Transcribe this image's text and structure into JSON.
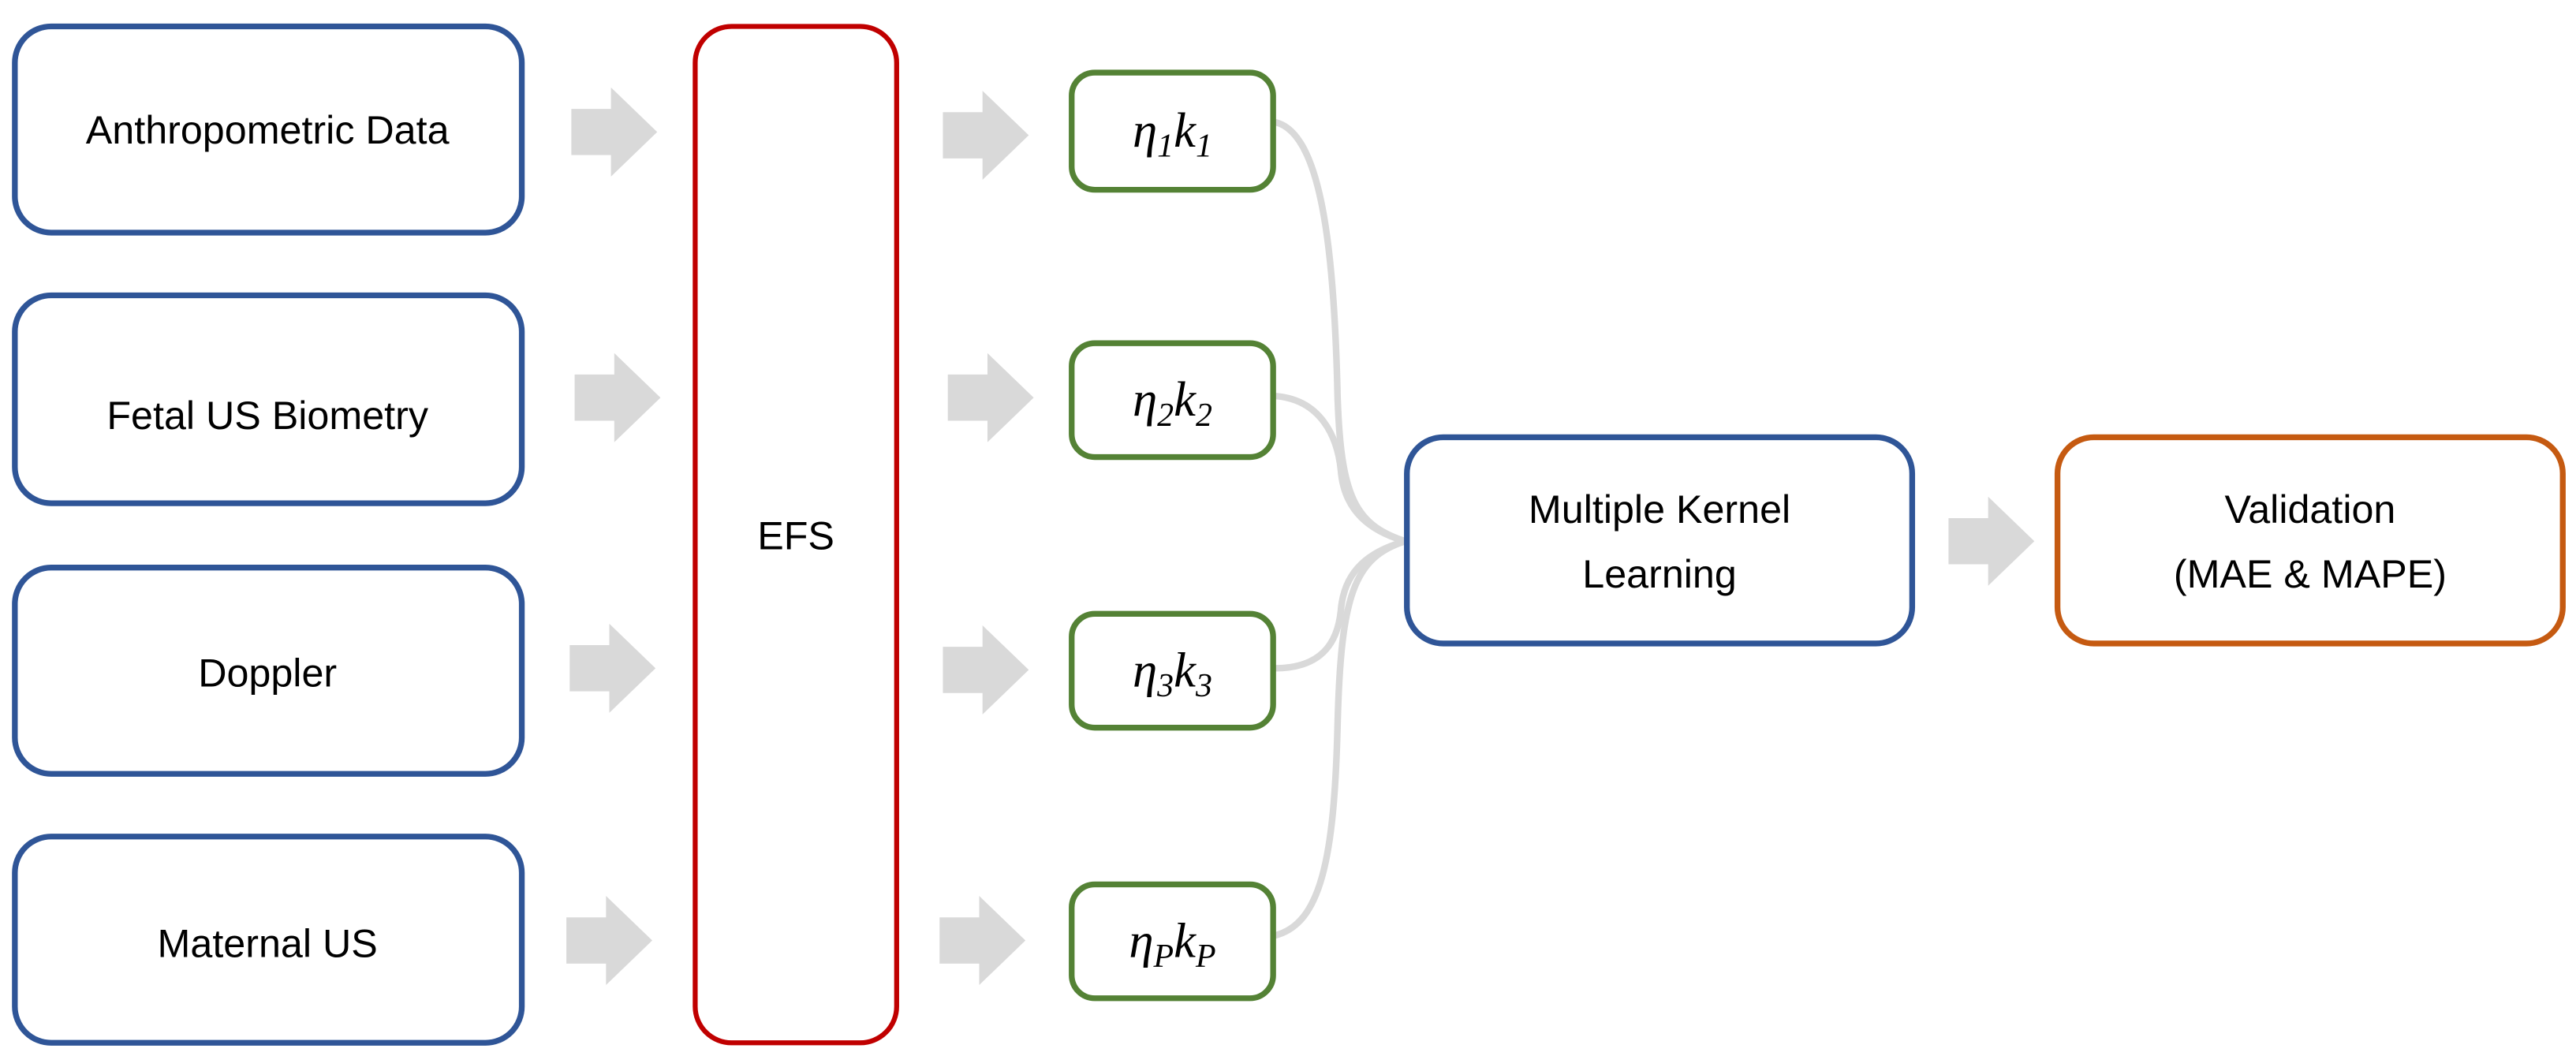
{
  "colors": {
    "input_border": "#2F5597",
    "efs_border": "#C00000",
    "kernel_border": "#548235",
    "mkl_border": "#2F5597",
    "validation_border": "#C55A11",
    "arrow_fill": "#D9D9D9",
    "connector": "#D9D9D9"
  },
  "inputs": [
    {
      "label": "Anthropometric Data"
    },
    {
      "label": "Fetal US Biometry"
    },
    {
      "label": "Doppler"
    },
    {
      "label": "Maternal US"
    }
  ],
  "efs": {
    "label": "EFS"
  },
  "kernels": [
    {
      "eta": "η",
      "eta_sub": "1",
      "k": "k",
      "k_sub": "1"
    },
    {
      "eta": "η",
      "eta_sub": "2",
      "k": "k",
      "k_sub": "2"
    },
    {
      "eta": "η",
      "eta_sub": "3",
      "k": "k",
      "k_sub": "3"
    },
    {
      "eta": "η",
      "eta_sub": "P",
      "k": "k",
      "k_sub": "P"
    }
  ],
  "mkl": {
    "line1": "Multiple Kernel",
    "line2": "Learning"
  },
  "validation": {
    "line1": "Validation",
    "line2": "(MAE & MAPE)"
  }
}
